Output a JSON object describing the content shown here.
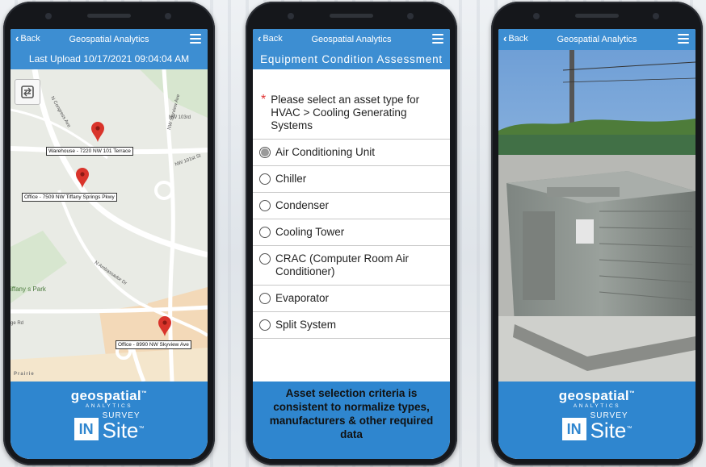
{
  "header": {
    "back_label": "Back",
    "title": "Geospatial Analytics"
  },
  "screen1": {
    "subtitle": "Last Upload 10/17/2021 09:04:04 AM",
    "map": {
      "pins": [
        {
          "label": "Warehouse - 7220 NW 101 Terrace"
        },
        {
          "label": "Office - 7509 NW Tiffany Springs Pkwy"
        },
        {
          "label": "Office - 8990 NW Skyview Ave"
        }
      ],
      "street_labels": [
        "N Congress Ave",
        "NW Skyview Ave",
        "N Ambassador Dr",
        "Prairie",
        "iffany s Park",
        "ge Rd",
        "NW 103rd",
        "NW 101st St"
      ]
    }
  },
  "screen2": {
    "subtitle": "Equipment Condition Assessment",
    "required_marker": "*",
    "question": "Please select an asset type for HVAC > Cooling Generating Systems",
    "options": [
      {
        "label": "Air Conditioning Unit",
        "selected": true
      },
      {
        "label": "Chiller",
        "selected": false
      },
      {
        "label": "Condenser",
        "selected": false
      },
      {
        "label": "Cooling Tower",
        "selected": false
      },
      {
        "label": "CRAC (Computer Room Air Conditioner)",
        "selected": false
      },
      {
        "label": "Evaporator",
        "selected": false
      },
      {
        "label": "Split System",
        "selected": false
      }
    ],
    "note": "Asset selection criteria is consistent to normalize types, manufacturers & other required data"
  },
  "brand": {
    "name": "geospatial",
    "tagline": "ANALYTICS",
    "in": "IN",
    "survey": "SURVEY",
    "site": "Site"
  },
  "colors": {
    "accent": "#3d8ed2",
    "footer": "#2f86cf",
    "required": "#e03030",
    "pin": "#d9342b"
  },
  "icons": [
    "back-chevron-icon",
    "hamburger-menu-icon",
    "rotate-icon",
    "map-pin-icon"
  ]
}
